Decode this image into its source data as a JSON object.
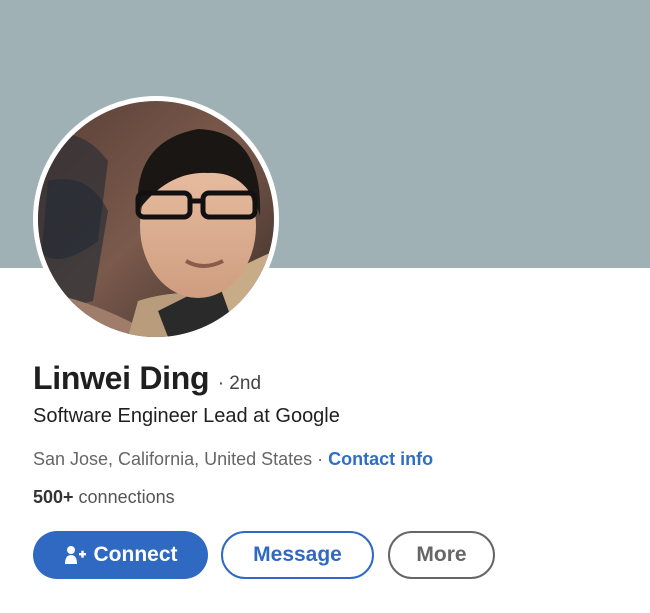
{
  "profile": {
    "name": "Linwei Ding",
    "degree": "· 2nd",
    "headline": "Software Engineer Lead at Google",
    "location": "San Jose, California, United States",
    "separator": " · ",
    "contact_info_label": "Contact info",
    "connections_count": "500+",
    "connections_label": " connections"
  },
  "actions": {
    "connect_label": "Connect",
    "message_label": "Message",
    "more_label": "More"
  },
  "colors": {
    "banner": "#a0b1b5",
    "accent": "#3069c2"
  },
  "icons": {
    "connect": "add-user-icon"
  }
}
